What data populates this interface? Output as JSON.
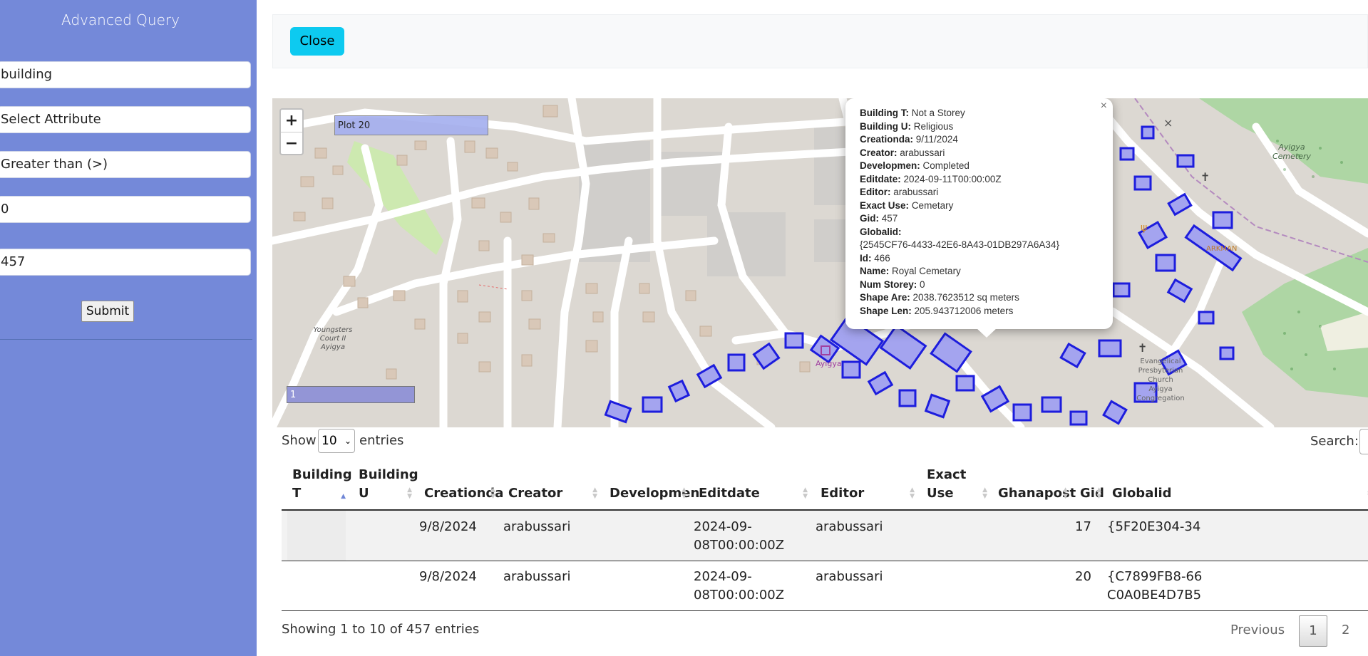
{
  "query_panel": {
    "title": "Advanced Query",
    "layer_value": "building",
    "attribute_value": "Select Attribute",
    "operator_value": "Greater than (>)",
    "value_input": "0",
    "result_count": "457",
    "submit_label": "Submit"
  },
  "toolbar": {
    "close_label": "Close"
  },
  "map": {
    "zoom_in": "+",
    "zoom_out": "−",
    "plot_label": "Plot 20",
    "feature_label": "1",
    "popup": {
      "close": "×",
      "fields": [
        {
          "key": "Building T:",
          "value": "Not a Storey"
        },
        {
          "key": "Building U:",
          "value": "Religious"
        },
        {
          "key": "Creationda:",
          "value": "9/11/2024"
        },
        {
          "key": "Creator:",
          "value": "arabussari"
        },
        {
          "key": "Developmen:",
          "value": "Completed"
        },
        {
          "key": "Editdate:",
          "value": "2024-09-11T00:00:00Z"
        },
        {
          "key": "Editor:",
          "value": "arabussari"
        },
        {
          "key": "Exact Use:",
          "value": "Cemetary"
        },
        {
          "key": "Gid:",
          "value": "457"
        },
        {
          "key": "Globalid:",
          "value": ""
        },
        {
          "key": "",
          "value": "{2545CF76-4433-42E6-8A43-01DB297A6A34}"
        },
        {
          "key": "Id:",
          "value": "466"
        },
        {
          "key": "Name:",
          "value": "Royal Cemetary"
        },
        {
          "key": "Num Storey:",
          "value": "0"
        },
        {
          "key": "Shape Are:",
          "value": "2038.7623512 sq meters"
        },
        {
          "key": "Shape Len:",
          "value": "205.943712006 meters"
        }
      ]
    },
    "map_labels": {
      "cemetery": "Ayigya Cemetery",
      "court": "Youngsters Court II Ayigya",
      "poi": "ARKMAN",
      "church_1": "Evangelical",
      "church_2": "Presbyterian",
      "church_3": "Church",
      "church_4": "Ayigya",
      "church_5": "Congregation",
      "ayigya": "Ayigya"
    }
  },
  "table_controls": {
    "show_label": "Show",
    "entries_value": "10",
    "entries_label": "entries",
    "search_label": "Search:"
  },
  "table": {
    "columns": [
      "Building T",
      "Building U",
      "Creationda",
      "Creator",
      "Developmen",
      "Editdate",
      "Editor",
      "Exact Use",
      "Ghanapost",
      "Gid",
      "Globalid"
    ],
    "rows": [
      [
        "",
        "",
        "9/8/2024",
        "arabussari",
        "",
        "2024-09-08T00:00:00Z",
        "arabussari",
        "",
        "",
        "17",
        "{5F20E304-34"
      ],
      [
        "",
        "",
        "9/8/2024",
        "arabussari",
        "",
        "2024-09-08T00:00:00Z",
        "arabussari",
        "",
        "",
        "20",
        "{C7899FB8-66 C0A0BE4D7B5"
      ]
    ]
  },
  "pagination": {
    "info": "Showing 1 to 10 of 457 entries",
    "previous": "Previous",
    "page_1": "1",
    "page_2": "2"
  }
}
